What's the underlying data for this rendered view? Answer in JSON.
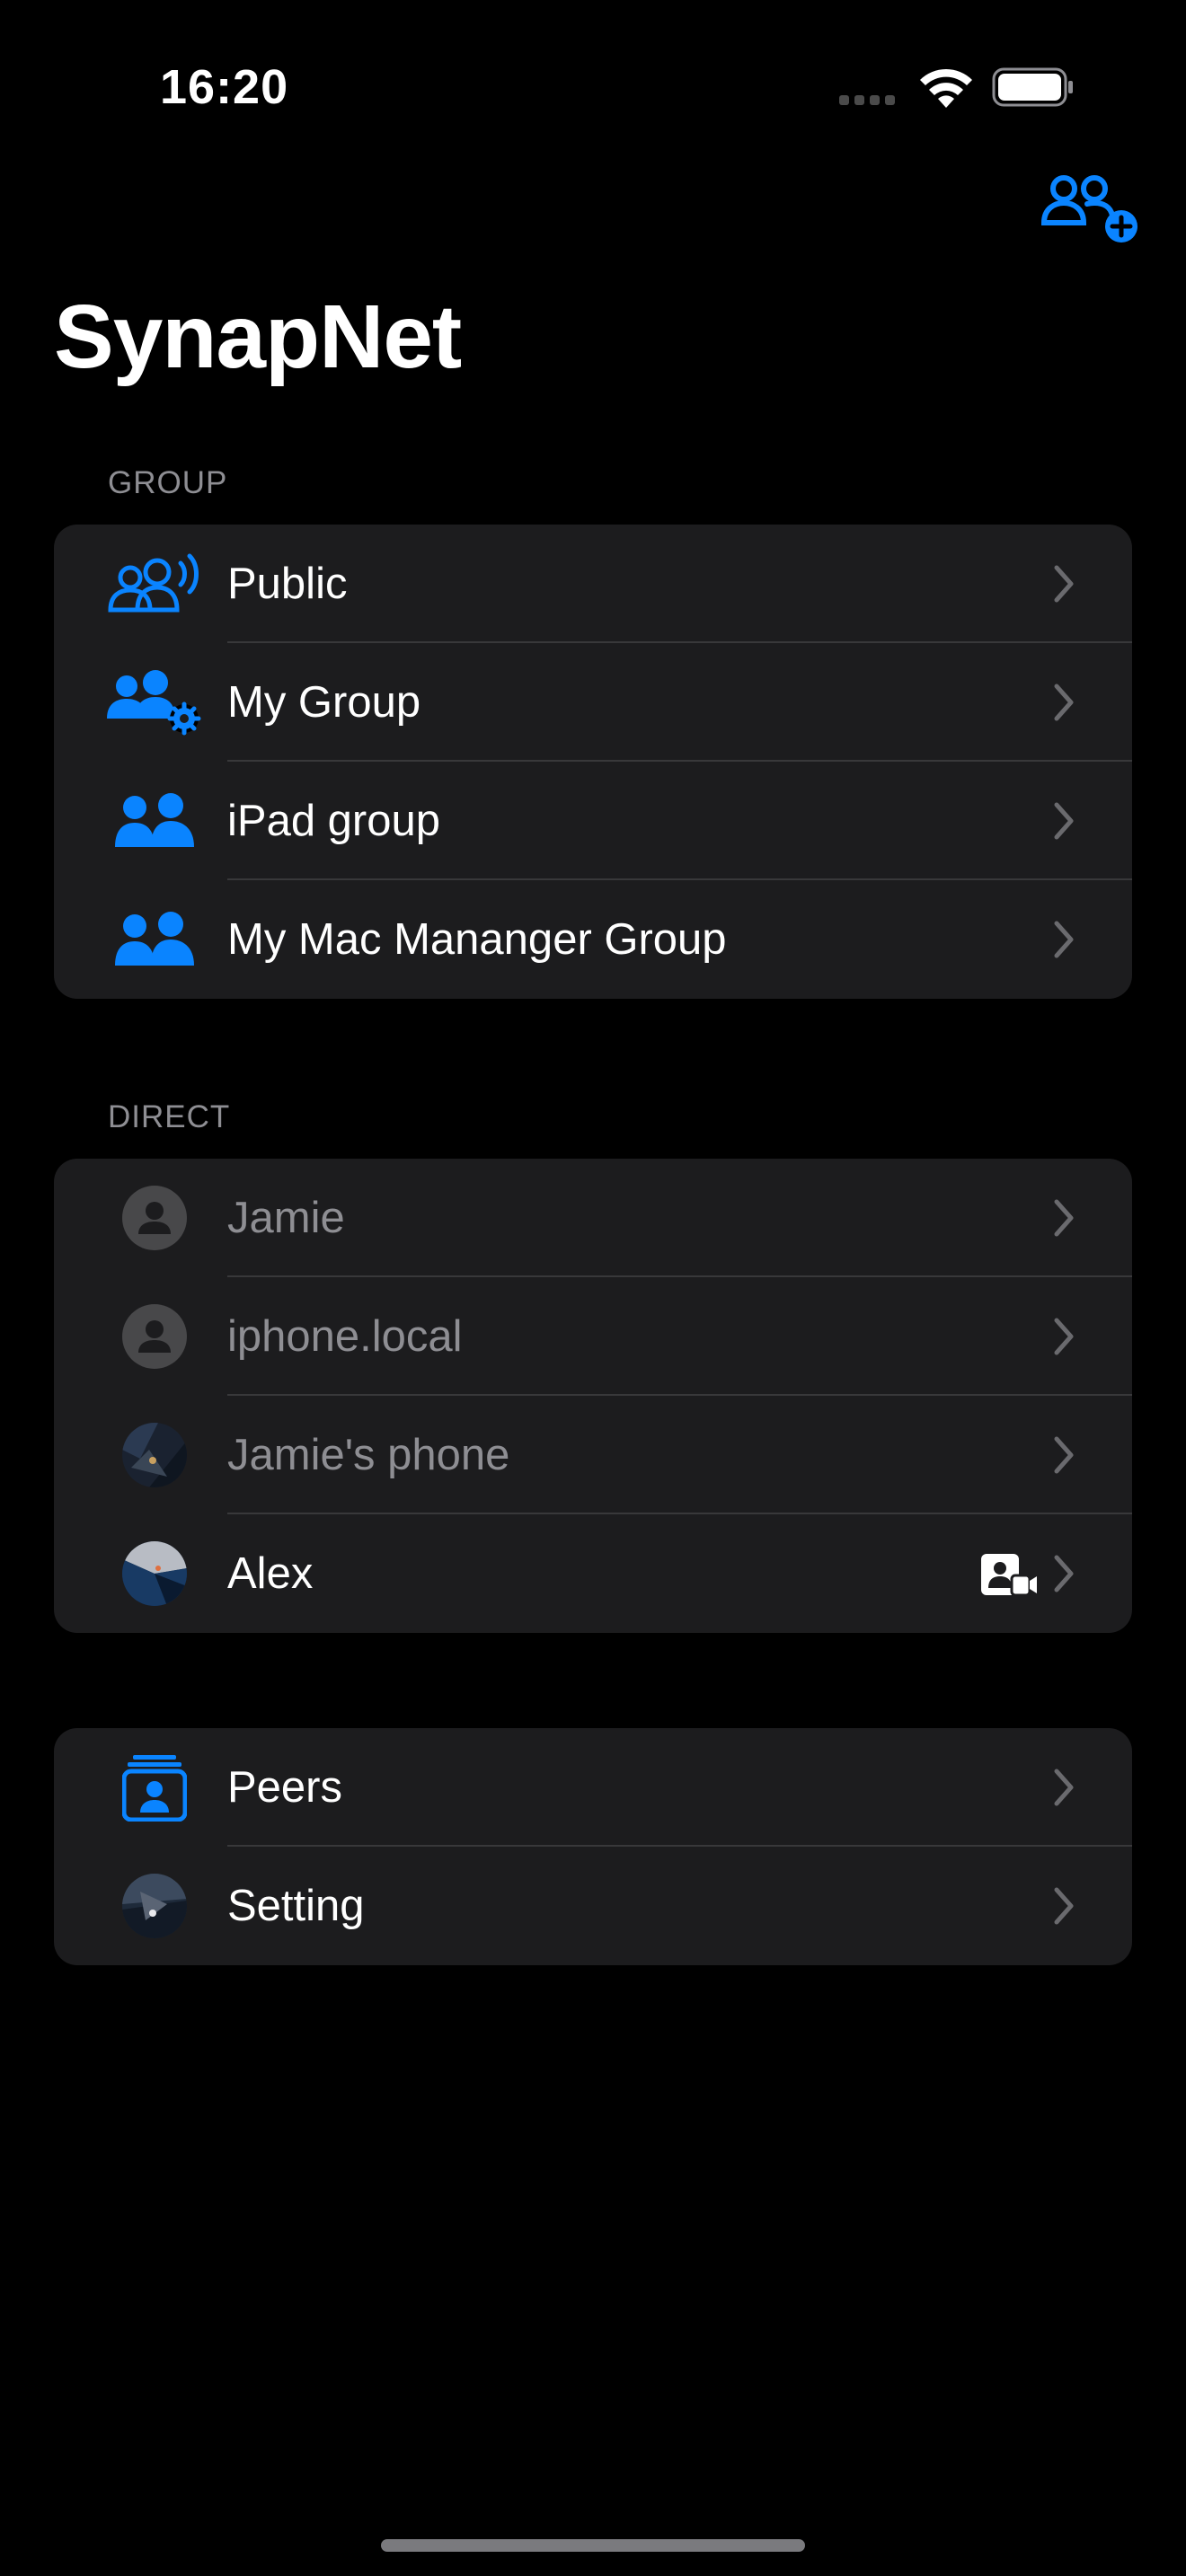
{
  "status_bar": {
    "time": "16:20"
  },
  "app": {
    "title": "SynapNet"
  },
  "toolbar": {
    "add_group_icon": "person-2-badge-plus-icon"
  },
  "colors": {
    "accent": "#0a84ff",
    "background": "#000000",
    "card": "#1c1c1e",
    "secondary_text": "#8e8e93"
  },
  "group_section": {
    "header": "GROUP",
    "items": [
      {
        "label": "Public",
        "icon": "people-broadcast-icon"
      },
      {
        "label": "My Group",
        "icon": "people-gear-icon"
      },
      {
        "label": "iPad group",
        "icon": "people-icon"
      },
      {
        "label": "My Mac Mananger Group",
        "icon": "people-icon"
      }
    ]
  },
  "direct_section": {
    "header": "DIRECT",
    "items": [
      {
        "label": "Jamie",
        "icon": "person-placeholder-avatar",
        "online": false
      },
      {
        "label": "iphone.local",
        "icon": "person-placeholder-avatar",
        "online": false
      },
      {
        "label": "Jamie's phone",
        "icon": "photo-avatar",
        "online": false
      },
      {
        "label": "Alex",
        "icon": "photo-avatar",
        "online": true,
        "badge": "contact-video-icon"
      }
    ]
  },
  "other_section": {
    "items": [
      {
        "label": "Peers",
        "icon": "person-stack-icon"
      },
      {
        "label": "Setting",
        "icon": "photo-avatar"
      }
    ]
  }
}
